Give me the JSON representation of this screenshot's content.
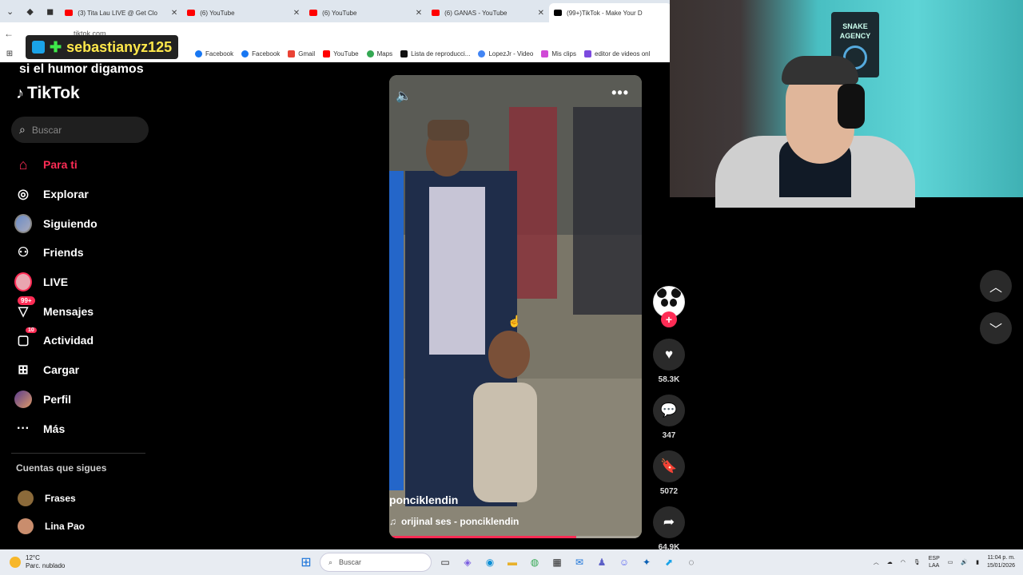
{
  "browser": {
    "tabs": [
      {
        "label": "(3) Tita Lau LIVE @ Get Clo",
        "favicon": "youtube"
      },
      {
        "label": "(6) YouTube",
        "favicon": "youtube"
      },
      {
        "label": "(6) YouTube",
        "favicon": "youtube"
      },
      {
        "label": "(6) GANAS - YouTube",
        "favicon": "youtube"
      },
      {
        "label": "(99+)TikTok - Make Your D",
        "favicon": "tiktok"
      }
    ],
    "url": "tiktok.com",
    "bookmarks": [
      "Facebook",
      "Facebook",
      "Gmail",
      "YouTube",
      "Maps",
      "Lista de reproducci...",
      "LopezJr - Video",
      "Mis clips",
      "editor de videos onl"
    ]
  },
  "stream": {
    "username": "sebastianyz125",
    "caption": "si el humor digamos",
    "colors": {
      "username": "#ffe84a",
      "plus": "#3ee84a"
    }
  },
  "tiktok": {
    "logo": "TikTok",
    "search_placeholder": "Buscar",
    "nav": [
      {
        "label": "Para ti",
        "icon": "home-icon",
        "active": true
      },
      {
        "label": "Explorar",
        "icon": "compass-icon"
      },
      {
        "label": "Siguiendo",
        "icon": "avatar-icon"
      },
      {
        "label": "Friends",
        "icon": "friends-icon"
      },
      {
        "label": "LIVE",
        "icon": "live-icon"
      },
      {
        "label": "Mensajes",
        "icon": "messages-icon",
        "badge": "99+"
      },
      {
        "label": "Actividad",
        "icon": "activity-icon",
        "badge": "10"
      },
      {
        "label": "Cargar",
        "icon": "upload-icon"
      },
      {
        "label": "Perfil",
        "icon": "profile-icon"
      },
      {
        "label": "Más",
        "icon": "more-icon"
      }
    ],
    "following_title": "Cuentas que sigues",
    "following": [
      "Frases",
      "Lina Pao"
    ],
    "accent": "#fe2c55"
  },
  "video": {
    "author": "ponciklendin",
    "sound": "orijinal ses - ponciklendin",
    "progress": 0.74
  },
  "actions": {
    "likes": "58.3K",
    "comments": "347",
    "saves": "5072",
    "shares": "64.9K"
  },
  "webcam": {
    "sign_text": "SNAKE AGENCY"
  },
  "taskbar": {
    "weather_temp": "12°C",
    "weather_desc": "Parc. nublado",
    "search_placeholder": "Buscar",
    "lang_top": "ESP",
    "lang_bottom": "LAA",
    "time": "11:04 p. m.",
    "date": "15/01/2026"
  }
}
